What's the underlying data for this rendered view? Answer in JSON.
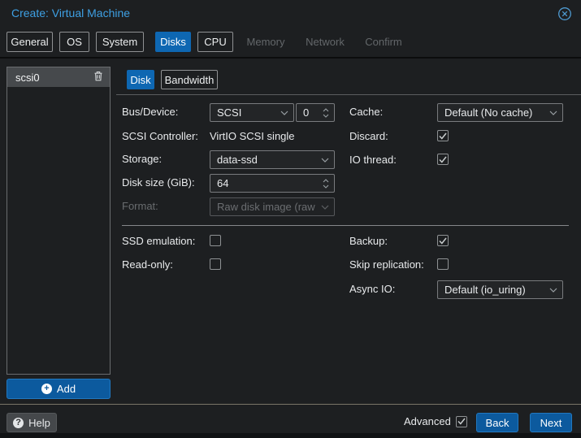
{
  "window": {
    "title": "Create: Virtual Machine"
  },
  "tabs": {
    "general": "General",
    "os": "OS",
    "system": "System",
    "disks": "Disks",
    "cpu": "CPU",
    "memory": "Memory",
    "network": "Network",
    "confirm": "Confirm",
    "active": "Disks",
    "disabled_tabs": [
      "Memory",
      "Network",
      "Confirm"
    ]
  },
  "sidebar": {
    "item": "scsi0",
    "item_selected": true,
    "add": "Add"
  },
  "subtabs": {
    "disk": "Disk",
    "bandwidth": "Bandwidth",
    "active": "Disk"
  },
  "fields": {
    "bus_label": "Bus/Device:",
    "bus_value": "SCSI",
    "bus_number": "0",
    "controller_label": "SCSI Controller:",
    "controller_value": "VirtIO SCSI single",
    "storage_label": "Storage:",
    "storage_value": "data-ssd",
    "disksize_label": "Disk size (GiB):",
    "disksize_value": "64",
    "format_label": "Format:",
    "format_value": "Raw disk image (raw",
    "format_disabled": true,
    "cache_label": "Cache:",
    "cache_value": "Default (No cache)",
    "discard_label": "Discard:",
    "discard_checked": true,
    "iothread_label": "IO thread:",
    "iothread_checked": true,
    "ssd_label": "SSD emulation:",
    "ssd_checked": false,
    "readonly_label": "Read-only:",
    "readonly_checked": false,
    "backup_label": "Backup:",
    "backup_checked": true,
    "skiprepl_label": "Skip replication:",
    "skiprepl_checked": false,
    "asyncio_label": "Async IO:",
    "asyncio_value": "Default (io_uring)"
  },
  "footer": {
    "help": "Help",
    "advanced": "Advanced",
    "advanced_checked": true,
    "back": "Back",
    "next": "Next"
  },
  "icons": {
    "close": "circled-x-icon",
    "trash": "trash-icon",
    "help": "question-circle-icon",
    "add": "plus-circle-icon",
    "chevron": "chevron-down-icon"
  },
  "colors": {
    "accent_blue": "#0e67b2",
    "button_blue": "#0c5a9e",
    "button_border": "#2178c0",
    "title_blue": "#3ea0e4",
    "background": "#1d1f21",
    "field_border": "#797b7e",
    "disabled_text": "#696c6f",
    "selected_row": "#46494c"
  }
}
